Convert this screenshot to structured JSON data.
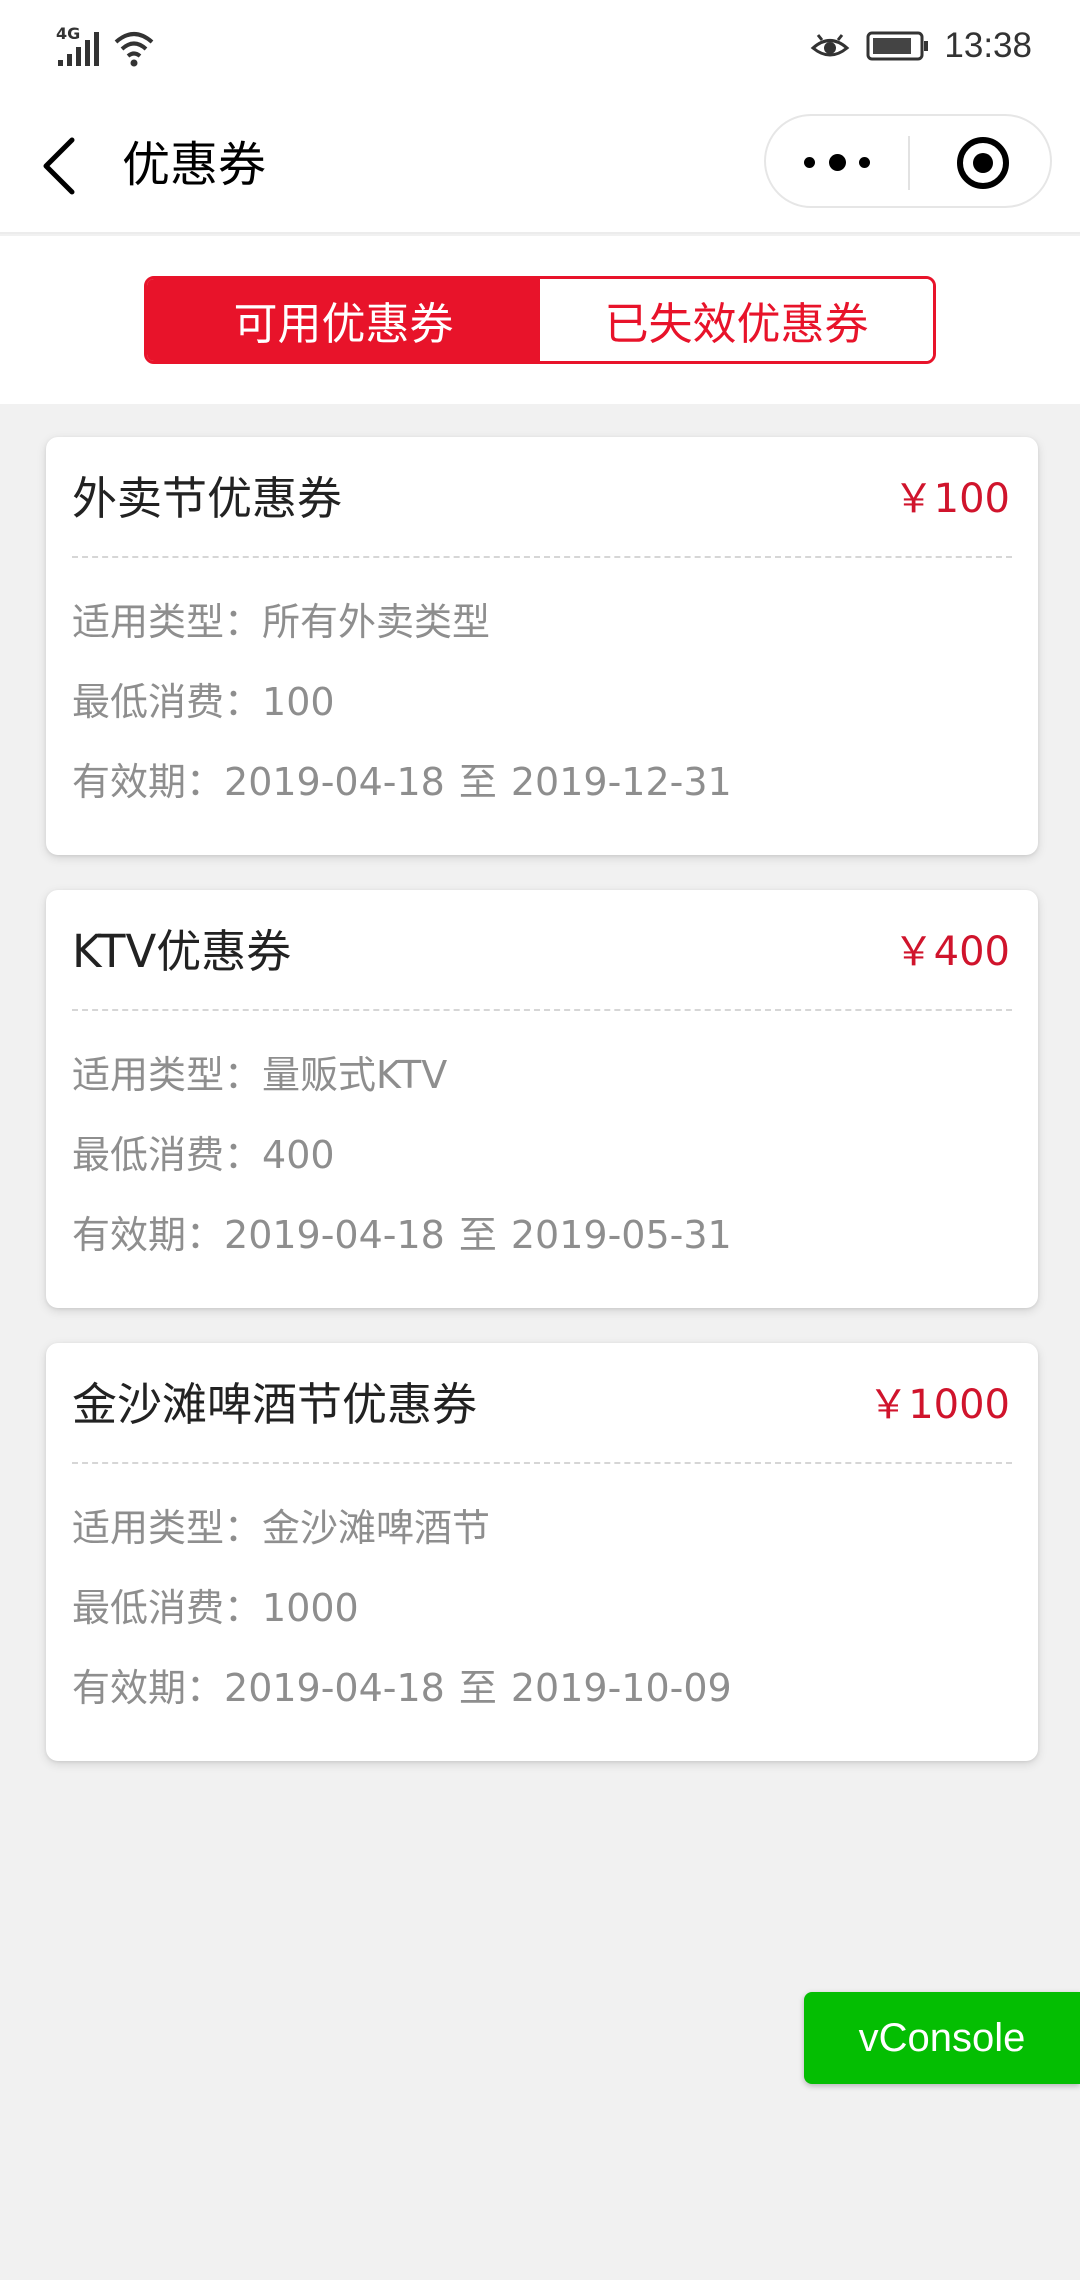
{
  "status_bar": {
    "network": "4G",
    "time": "13:38",
    "icons": [
      "signal-icon",
      "wifi-icon",
      "eye-icon",
      "battery-icon"
    ]
  },
  "nav": {
    "title": "优惠券",
    "icons": [
      "back-arrow-icon",
      "more-dots-icon",
      "target-icon"
    ]
  },
  "tabs": [
    {
      "label": "可用优惠券",
      "active": true
    },
    {
      "label": "已失效优惠券",
      "active": false
    }
  ],
  "coupons": [
    {
      "name": "外卖节优惠券",
      "amount": "￥100",
      "type_label": "适用类型：",
      "type_value": "所有外卖类型",
      "min_label": "最低消费：",
      "min_value": "100",
      "valid_label": "有效期：",
      "valid_from": "2019-04-18",
      "valid_sep": "至",
      "valid_to": "2019-12-31"
    },
    {
      "name": "KTV优惠券",
      "amount": "￥400",
      "type_label": "适用类型：",
      "type_value": "量贩式KTV",
      "min_label": "最低消费：",
      "min_value": "400",
      "valid_label": "有效期：",
      "valid_from": "2019-04-18",
      "valid_sep": "至",
      "valid_to": "2019-05-31"
    },
    {
      "name": "金沙滩啤酒节优惠券",
      "amount": "￥1000",
      "type_label": "适用类型：",
      "type_value": "金沙滩啤酒节",
      "min_label": "最低消费：",
      "min_value": "1000",
      "valid_label": "有效期：",
      "valid_from": "2019-04-18",
      "valid_sep": "至",
      "valid_to": "2019-10-09"
    }
  ],
  "vconsole": {
    "label": "vConsole"
  },
  "colors": {
    "accent": "#e8132a",
    "amount": "#d0142c",
    "vconsole": "#04be02",
    "background": "#f1f1f1"
  }
}
